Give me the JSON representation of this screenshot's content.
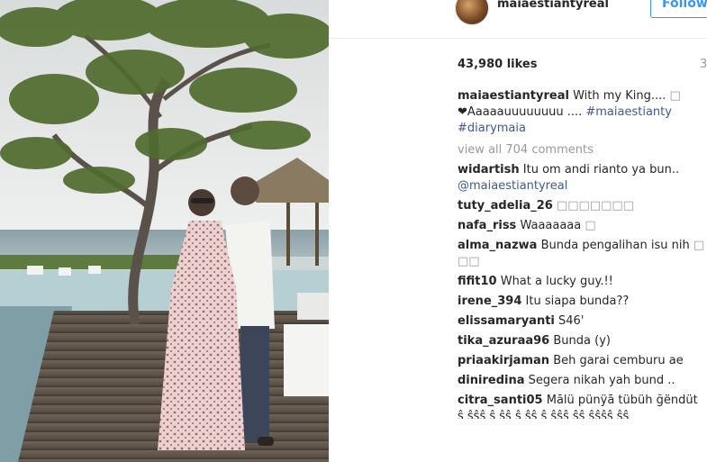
{
  "post": {
    "username": "maiaestiantyreal",
    "follow_label": "Follow",
    "likes": "43,980 likes",
    "time_partial": "3"
  },
  "caption": {
    "user": "maiaestiantyreal",
    "line1": "With my King.... ",
    "line2": "❤Aaaaauuuuuuuu .... ",
    "tag1": "#maiaestianty",
    "tag2": "#diarymaia"
  },
  "view_all": "view all 704 comments",
  "comments": [
    {
      "user": "widartish",
      "text": "Itu om andi rianto ya bun..",
      "mention": "@maiaestiantyreal"
    },
    {
      "user": "tuty_adelia_26",
      "text": "",
      "glyphs": "□□□□□□□"
    },
    {
      "user": "nafa_riss",
      "text": "Waaaaaaa ",
      "glyphs": "□"
    },
    {
      "user": "alma_nazwa",
      "text": "Bunda pengalihan isu nih ",
      "glyphs": "□",
      "line2": "□□"
    },
    {
      "user": "fifit10",
      "text": "What a lucky guy.!!"
    },
    {
      "user": "irene_394",
      "text": "Itu siapa bunda??"
    },
    {
      "user": "elissamaryanti",
      "text": "S46'"
    },
    {
      "user": "tika_azuraa96",
      "text": "Bunda (y)"
    },
    {
      "user": "priaakirjaman",
      "text": "Beh garai cemburu ae"
    },
    {
      "user": "diniredina",
      "text": "Segera nikah yah bund .."
    },
    {
      "user": "citra_santi05",
      "text": "Mālü pünÿā tübüh ğëndüt",
      "line2": "ŝ ŝŝŝ ŝ  ŝŝ ŝ ŝŝ ŝ ŝŝŝ ŝŝ ŝŝŝŝ ŝŝ"
    }
  ]
}
